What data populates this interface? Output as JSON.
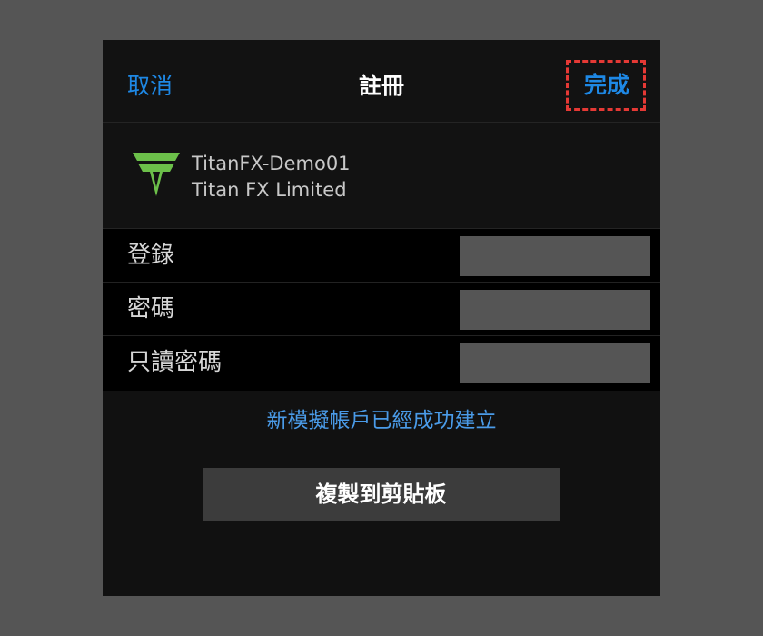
{
  "header": {
    "cancel_label": "取消",
    "title": "註冊",
    "done_label": "完成"
  },
  "account": {
    "logo_icon": "titan-fx-logo-icon",
    "server_name": "TitanFX-Demo01",
    "company": "Titan FX Limited"
  },
  "fields": [
    {
      "label": "登錄",
      "value": ""
    },
    {
      "label": "密碼",
      "value": ""
    },
    {
      "label": "只讀密碼",
      "value": ""
    }
  ],
  "status_message": "新模擬帳戶已經成功建立",
  "copy_button_label": "複製到剪貼板",
  "colors": {
    "accent": "#1e88e5",
    "highlight_border": "#e53935",
    "logo_green": "#6cc04a"
  }
}
